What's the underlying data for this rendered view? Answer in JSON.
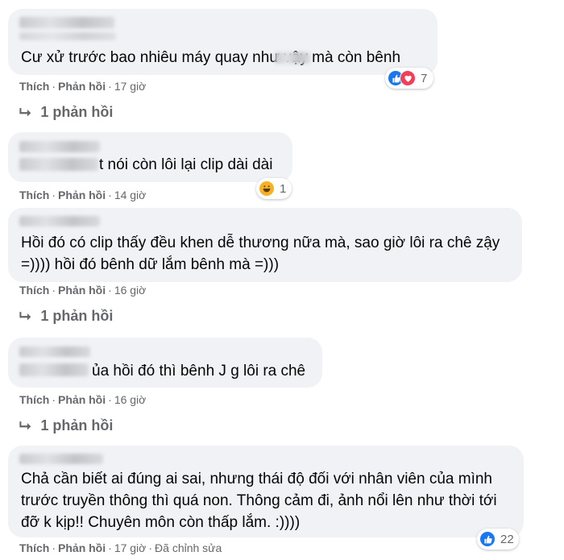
{
  "actions": {
    "like": "Thích",
    "reply": "Phản hồi"
  },
  "comments": [
    {
      "text_lines": [
        "Cư xử trước bao nhiêu máy quay như      vậy mà còn bênh"
      ],
      "time": "17 giờ",
      "reaction_count": "7",
      "reactions": [
        "like-icon",
        "love-icon"
      ],
      "replies_label": "1 phản hồi"
    },
    {
      "text_lines": [
        "t nói còn lôi lại clip dài dài"
      ],
      "time": "14 giờ",
      "reaction_count": "1",
      "reactions": [
        "haha-icon"
      ]
    },
    {
      "text_lines": [
        "Hồi đó có clip thấy đều khen dễ thương nữa mà, sao giờ lôi ra chê zậy",
        "=)))) hồi đó bênh dữ lắm bênh mà =)))"
      ],
      "time": "16 giờ",
      "replies_label": "1 phản hồi"
    },
    {
      "text_lines": [
        "ủa hồi đó thì bênh J g lôi ra chê"
      ],
      "time": "16 giờ",
      "replies_label": "1 phản hồi"
    },
    {
      "text_lines": [
        "Chả cần biết ai đúng ai sai, nhưng thái độ đối với nhân viên của mình",
        "trước truyền thông thì quá non. Thông cảm đi, ảnh nổi lên như thời tới",
        "đỡ k kịp!! Chuyên môn còn thấp lắm. :))))"
      ],
      "time": "17 giờ",
      "edited": "Đã chỉnh sửa",
      "reaction_count": "22",
      "reactions": [
        "like-icon"
      ]
    }
  ],
  "colors": {
    "bubble": "#f0f2f5",
    "meta": "#65676b",
    "like": "#1877f2",
    "love": "#f33e58",
    "haha": "#f7b125"
  }
}
